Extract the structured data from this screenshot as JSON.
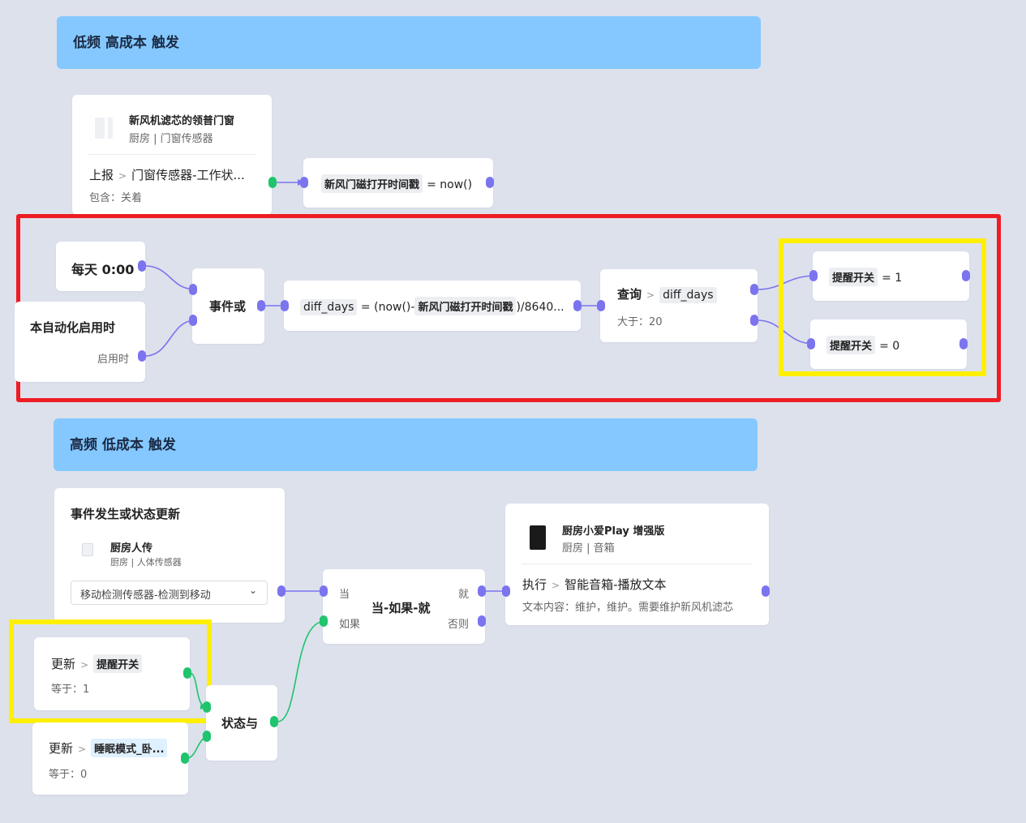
{
  "colors": {
    "background": "#dde1ec",
    "banner": "#84c8ff",
    "port": "#7b74ee",
    "port_true": "#1fc46d",
    "highlight_red": "#ee1c23",
    "highlight_yellow": "#ffef00"
  },
  "section_low": {
    "title": "低频 高成本 触发"
  },
  "section_high": {
    "title": "高频 低成本 触发"
  },
  "door_sensor": {
    "icon": "door-sensor-icon",
    "name": "新风机滤芯的领普门窗",
    "location": "厨房 | 门窗传感器",
    "action": "上报",
    "property": "门窗传感器-工作状...",
    "condition": "包含：关着"
  },
  "set_timestamp": {
    "var": "新风门磁打开时间戳",
    "expr": "= now()"
  },
  "daily": {
    "label": "每天 0:00"
  },
  "on_enable": {
    "label": "本自动化启用时",
    "sub": "启用时"
  },
  "event_or": {
    "label": "事件或"
  },
  "diff_calc": {
    "var": "diff_days",
    "expr_a": "= (now()-",
    "var2": "新风门磁打开时间戳",
    "expr_b": ")/8640..."
  },
  "query": {
    "action": "查询",
    "var": "diff_days",
    "condition": "大于：20"
  },
  "set_on": {
    "var": "提醒开关",
    "expr": "= 1"
  },
  "set_off": {
    "var": "提醒开关",
    "expr": "= 0"
  },
  "event_state": {
    "title": "事件发生或状态更新",
    "device_icon": "motion-sensor-icon",
    "device_name": "厨房人传",
    "device_location": "厨房 | 人体传感器",
    "select_value": "移动检测传感器-检测到移动"
  },
  "when_if": {
    "label": "当-如果-就",
    "when": "当",
    "if": "如果",
    "then": "就",
    "else": "否则"
  },
  "speaker": {
    "icon": "smart-speaker-icon",
    "name": "厨房小爱Play 增强版",
    "location": "厨房 | 音箱",
    "action": "执行",
    "property": "智能音箱-播放文本",
    "content": "文本内容：维护，维护。需要维护新风机滤芯"
  },
  "update_reminder": {
    "action": "更新",
    "var": "提醒开关",
    "condition": "等于：1"
  },
  "update_sleep": {
    "action": "更新",
    "var": "睡眠模式_卧...",
    "condition": "等于：0"
  },
  "state_and": {
    "label": "状态与"
  }
}
